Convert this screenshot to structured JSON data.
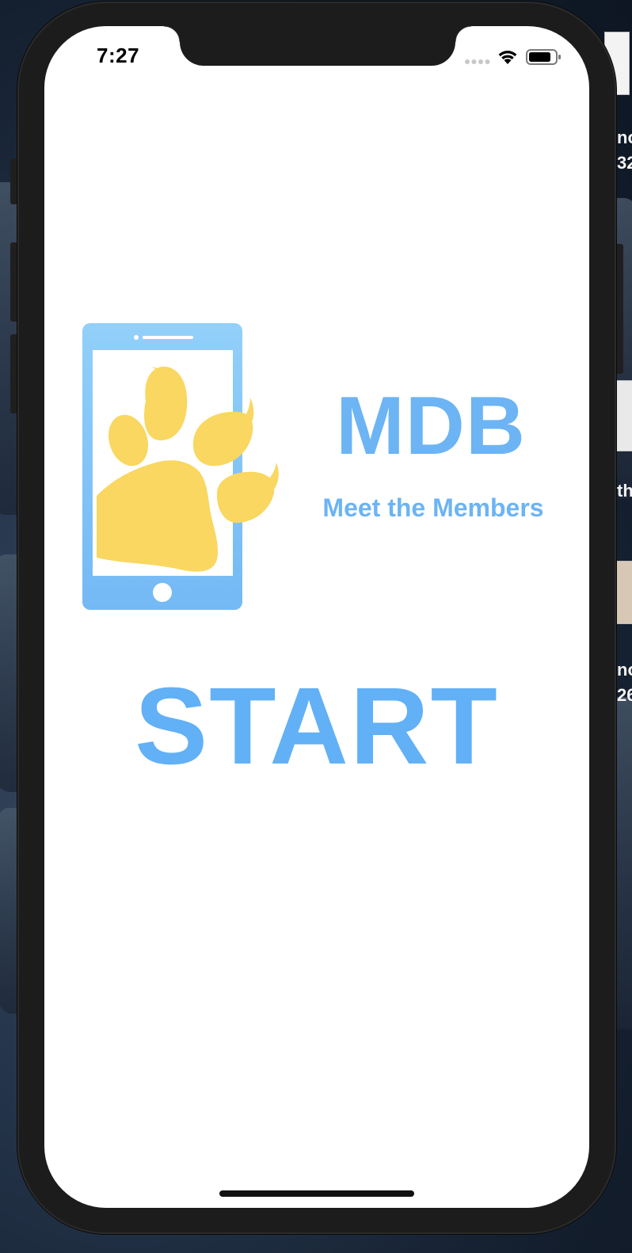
{
  "status_bar": {
    "time": "7:27",
    "icons": [
      "cellular-signal-icon",
      "wifi-icon",
      "battery-icon"
    ]
  },
  "brand": {
    "title": "MDB",
    "subtitle": "Meet the Members",
    "logo_icon": "phone-with-paw-icon"
  },
  "start_button": {
    "label": "START"
  },
  "desktop_edge": {
    "text_1": "no\n32",
    "text_2": "th",
    "text_3": "no\n26"
  },
  "colors": {
    "brand_blue": "#6cb4f4",
    "start_blue": "#62b0f6",
    "paw_yellow": "#f9d760",
    "phone_blue": "#8ecdf8"
  }
}
